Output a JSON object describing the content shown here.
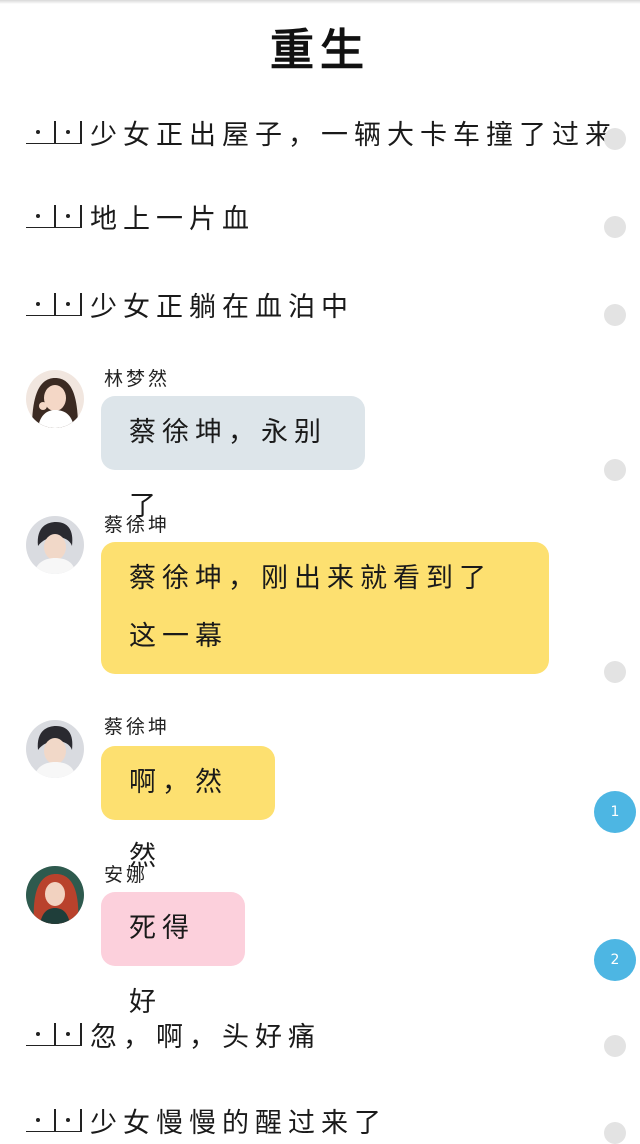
{
  "title": "重生",
  "narrations": [
    {
      "text": "少女正出屋子，一辆大卡车撞了过来"
    },
    {
      "text": "地上一片血"
    },
    {
      "text": "少女正躺在血泊中"
    },
    {
      "text": "忽，啊，头好痛"
    },
    {
      "text": "少女慢慢的醒过来了"
    }
  ],
  "messages": [
    {
      "speaker": "林梦然",
      "text": "蔡徐坤，永别了",
      "bubble_color": "#dde5ea"
    },
    {
      "speaker": "蔡徐坤",
      "text": "蔡徐坤，刚出来就看到了这一幕",
      "bubble_color": "#fde070"
    },
    {
      "speaker": "蔡徐坤",
      "text": "啊，然然",
      "bubble_color": "#fde070"
    },
    {
      "speaker": "安娜",
      "text": "死得好",
      "bubble_color": "#fcd0dc"
    }
  ],
  "indicators": [
    {
      "label": "1"
    },
    {
      "label": "2"
    }
  ],
  "icons": {
    "narration_marker": "narration-marker-icon",
    "read_status": "gray-dot-icon"
  },
  "colors": {
    "indicator_blue": "#4db6e3",
    "status_gray": "#e3e3e3"
  }
}
